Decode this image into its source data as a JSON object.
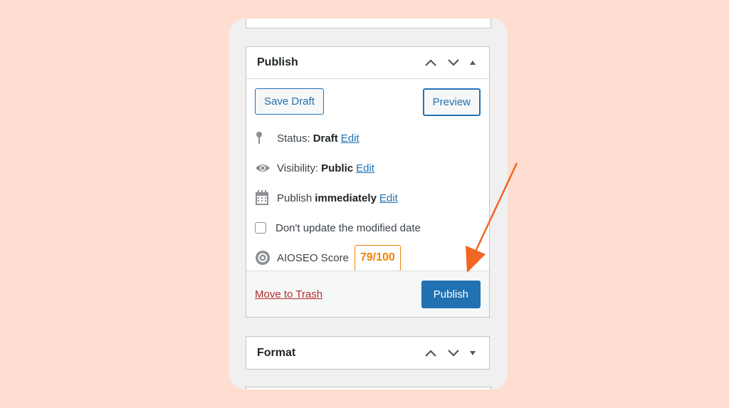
{
  "publish": {
    "title": "Publish",
    "save_draft": "Save Draft",
    "preview": "Preview",
    "status_label": "Status:",
    "status_value": "Draft",
    "visibility_label": "Visibility:",
    "visibility_value": "Public",
    "schedule_label": "Publish",
    "schedule_value": "immediately",
    "edit_link": "Edit",
    "dont_update_label": "Don't update the modified date",
    "dont_update_checked": false,
    "aioseo_label": "AIOSEO Score",
    "aioseo_score": "79/100",
    "move_to_trash": "Move to Trash",
    "publish_button": "Publish"
  },
  "format": {
    "title": "Format"
  },
  "icons": {
    "move_up": "chevron-up-icon",
    "move_down": "chevron-down-icon",
    "toggle": "triangle-toggle-icon",
    "status": "pin-icon",
    "visibility": "eye-icon",
    "schedule": "calendar-icon",
    "aioseo": "gear-icon"
  },
  "colors": {
    "background": "#fdded0",
    "accent": "#2271b1",
    "score": "#f18200",
    "trash": "#b32d2e",
    "arrow": "#f26522"
  }
}
